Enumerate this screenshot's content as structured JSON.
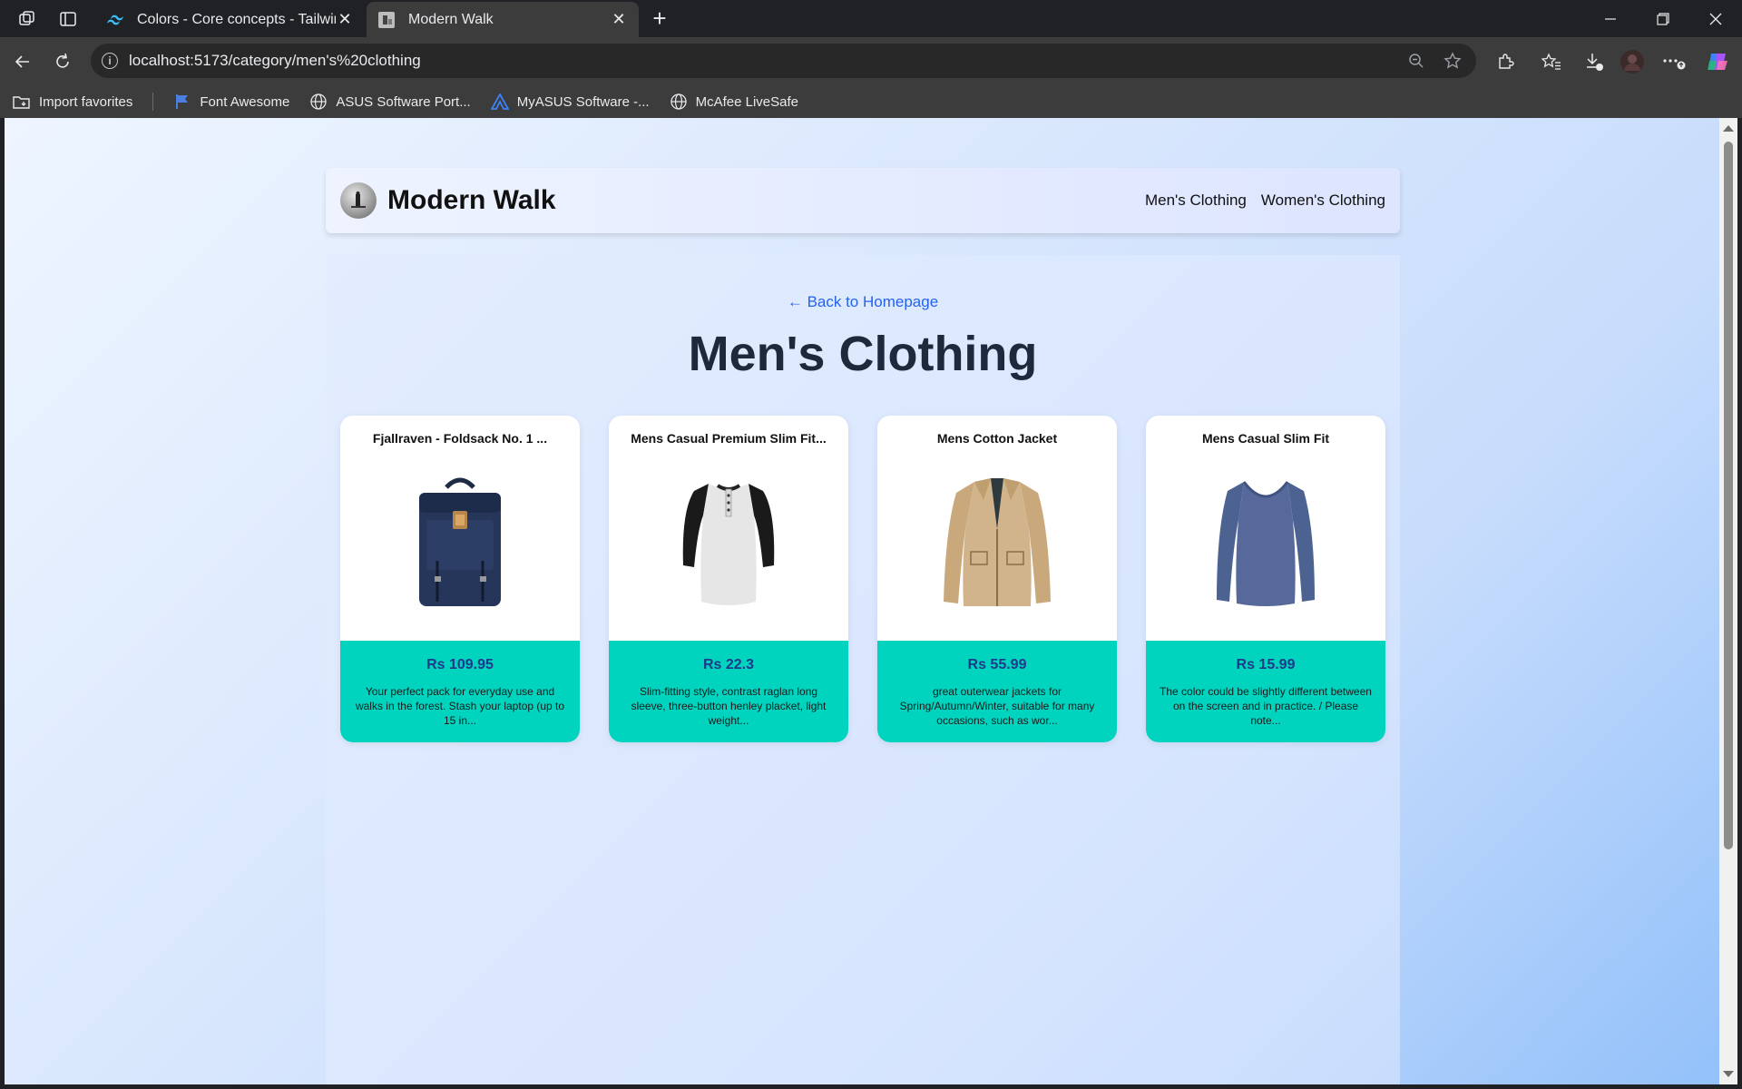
{
  "browser": {
    "tabs": [
      {
        "title": "Colors - Core concepts - Tailwind",
        "active": false
      },
      {
        "title": "Modern Walk",
        "active": true
      }
    ],
    "url": "localhost:5173/category/men's%20clothing",
    "bookmarks": [
      {
        "label": "Import favorites",
        "icon": "import-icon"
      },
      {
        "label": "Font Awesome",
        "icon": "flag-icon"
      },
      {
        "label": "ASUS Software Port...",
        "icon": "globe-icon"
      },
      {
        "label": "MyASUS Software -...",
        "icon": "asus-icon"
      },
      {
        "label": "McAfee LiveSafe",
        "icon": "globe-icon"
      }
    ]
  },
  "site": {
    "brand": "Modern Walk",
    "nav": [
      "Men's Clothing",
      "Women's Clothing"
    ]
  },
  "page": {
    "back_link": "← Back to Homepage",
    "title": "Men's Clothing"
  },
  "products": [
    {
      "title": "Fjallraven - Foldsack No. 1 ...",
      "price": "Rs 109.95",
      "description": "Your perfect pack for everyday use and walks in the forest. Stash your laptop (up to 15 in...",
      "image": "backpack"
    },
    {
      "title": "Mens Casual Premium Slim Fit...",
      "price": "Rs 22.3",
      "description": "Slim-fitting style, contrast raglan long sleeve, three-button henley placket, light weight...",
      "image": "raglan-tshirt"
    },
    {
      "title": "Mens Cotton Jacket",
      "price": "Rs 55.99",
      "description": "great outerwear jackets for Spring/Autumn/Winter, suitable for many occasions, such as wor...",
      "image": "cotton-jacket"
    },
    {
      "title": "Mens Casual Slim Fit",
      "price": "Rs 15.99",
      "description": "The color could be slightly different between on the screen and in practice. / Please note...",
      "image": "longsleeve-shirt"
    }
  ],
  "colors": {
    "card_info_bg": "#00d4bf",
    "price_text": "#1e3a8a",
    "link": "#2563eb"
  }
}
